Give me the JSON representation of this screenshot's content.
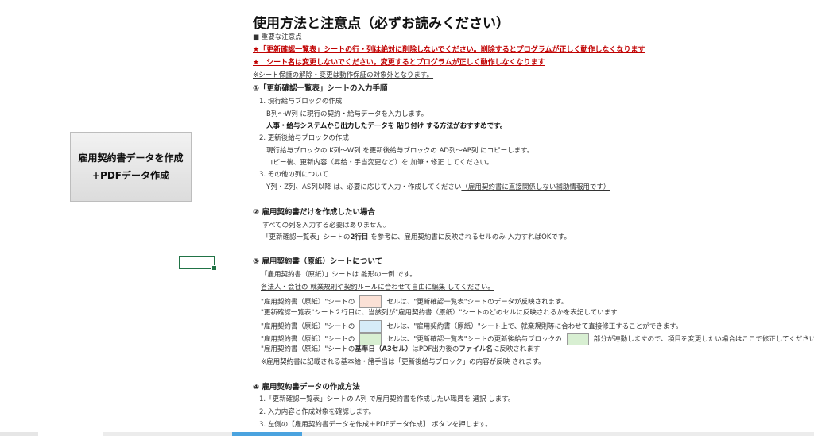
{
  "title": "使用方法と注意点（必ずお読みください）",
  "important_label": "■ 重要な注意点",
  "warn1": "★「更新確認一覧表」シートの行・列は絶対に削除しないでください。削除するとプログラムが正しく動作しなくなります",
  "warn2": "★　シート名は変更しないでください。変更するとプログラムが正しく動作しなくなります",
  "note": "※シート保護の解除・変更は動作保証の対象外となります。",
  "s1": {
    "heading": "①「更新確認一覧表」シートの入力手順",
    "i1": "1. 現行給与ブロックの作成",
    "i1a": "B列～W列 に現行の契約・給与データを入力します。",
    "i1b": "人事・給与システムから出力したデータを 貼り付け する方法がおすすめです。",
    "i2": "2. 更新後給与ブロックの作成",
    "i2a": "現行給与ブロックの K列～W列 を更新後給与ブロックの AD列～AP列 にコピーします。",
    "i2b": "コピー後、更新内容（昇給・手当変更など）を 加筆・修正 してください。",
    "i3": "3. その他の列について",
    "i3a": "Y列・Z列、AS列以降 は、必要に応じて入力・作成してください",
    "i3b": "（雇用契約書に直接関係しない補助情報用です）"
  },
  "s2": {
    "heading": "② 雇用契約書だけを作成したい場合",
    "a": "すべての列を入力する必要はありません。",
    "b1": "「更新確認一覧表」シートの",
    "b2": "2行目",
    "b3": " を参考に、雇用契約書に反映されるセルのみ 入力すればOKです。"
  },
  "s3": {
    "heading": "③ 雇用契約書（原紙）シートについて",
    "a": "「雇用契約書（原紙）」シートは 雛形の一例 です。",
    "b": "各法人・会社の 就業規則や契約ルールに合わせて自由に編集 してください。",
    "c1": "\"雇用契約書（原紙）\"シートの",
    "c2": "セルは、\"更新確認一覧表\"シートのデータが反映されます。",
    "d": "\"更新確認一覧表\"シート２行目に、当該列が\"雇用契約書（原紙）\"シートのどのセルに反映されるかを表記しています",
    "e1": "\"雇用契約書（原紙）\"シートの",
    "e2": "セルは、\"雇用契約書（原紙）\"シート上で、就業規則等に合わせて直接修正することができます。",
    "f1": "\"雇用契約書（原紙）\"シートの",
    "f2": "セルは、\"更新確認一覧表\"シートの更新後給与ブロックの",
    "f3": "部分が連動しますので、項目を変更したい場合はここで修正してください",
    "g1": "\"雇用契約書（原紙）\"シートの",
    "g2": "基準日（A3セル）",
    "g3": "はPDF出力後の",
    "g4": "ファイル名",
    "g5": "に反映されます",
    "h": "※雇用契約書に記載される基本給・諸手当は「更新後給与ブロック」の内容が反映 されます。"
  },
  "s4": {
    "heading": "④ 雇用契約書データの作成方法",
    "a": "1.「更新確認一覧表」シートの A列 で雇用契約書を作成したい職員を 選択 します。",
    "b": "2. 入力内容と作成対象を確認します。",
    "c": "3. 左側の【雇用契約書データを作成＋PDFデータ作成】 ボタンを押します。"
  },
  "button": {
    "line1": "雇用契約書データを作成",
    "line2": "+PDFデータ作成"
  },
  "colors": {
    "pink": "#fbe1d6",
    "blue": "#d6ecf8",
    "green": "#d8efd2",
    "red": "#c00000"
  }
}
